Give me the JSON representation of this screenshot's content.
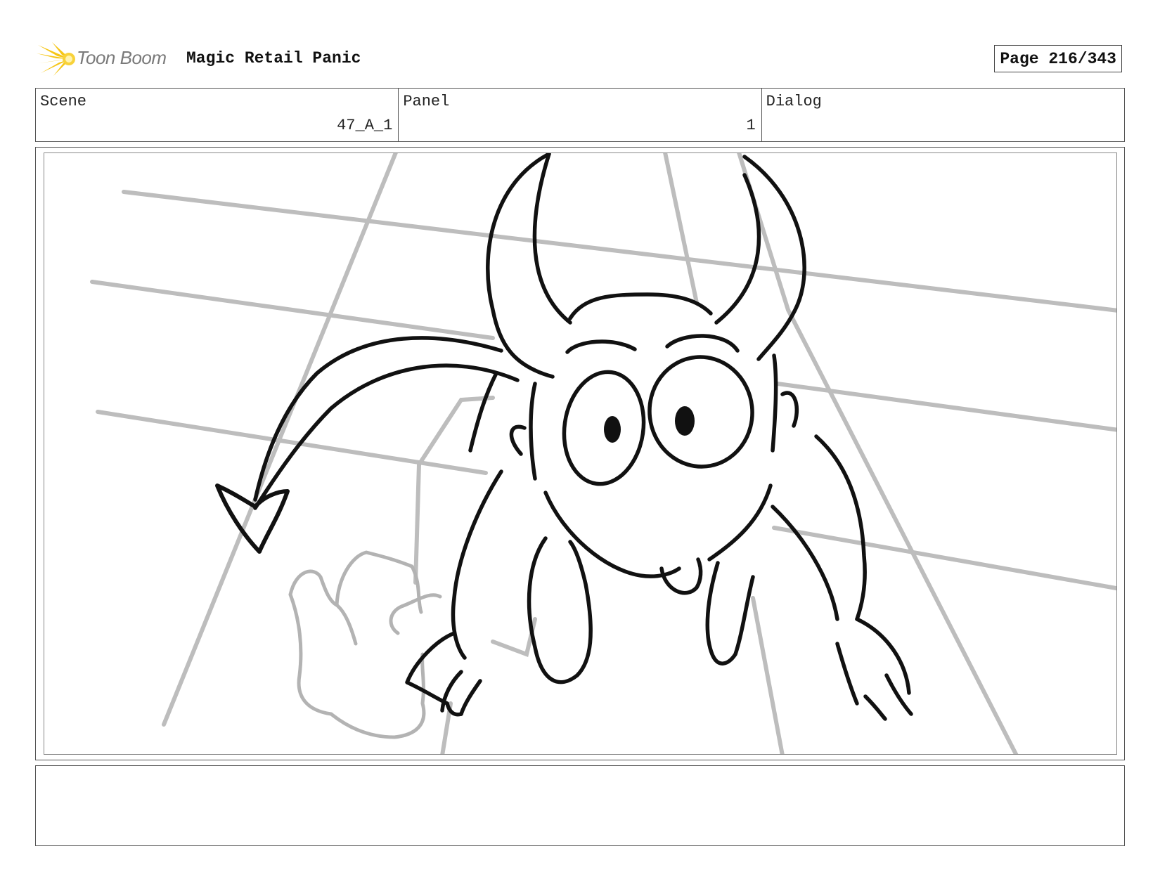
{
  "header": {
    "logo_text": "Toon Boom",
    "project_title": "Magic Retail Panic",
    "page_label": "Page 216/343"
  },
  "info": {
    "scene_label": "Scene",
    "scene_value": "47_A_1",
    "panel_label": "Panel",
    "panel_value": "1",
    "dialog_label": "Dialog",
    "dialog_value": ""
  },
  "notes": {
    "text": ""
  },
  "colors": {
    "logo_flare": "#f6c616",
    "guide_lines": "#bdbdbd",
    "ink": "#111111"
  },
  "icons": {
    "logo": "toon-boom-starburst-icon"
  }
}
